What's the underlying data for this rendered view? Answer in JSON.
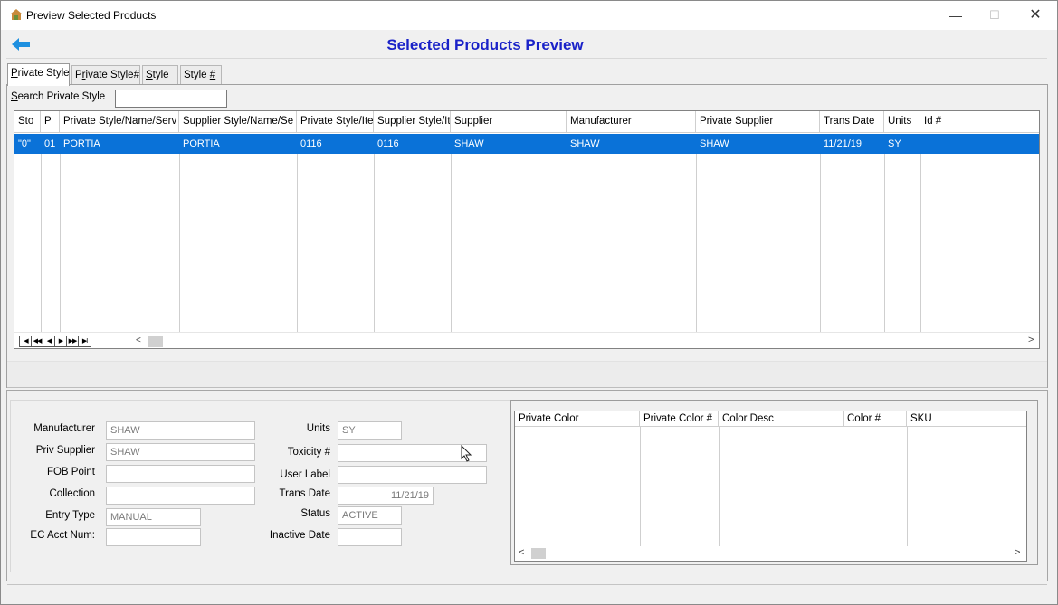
{
  "window": {
    "title": "Preview Selected Products",
    "minimize": "—",
    "maximize": "☐",
    "close": "✕"
  },
  "header": {
    "title": "Selected Products Preview"
  },
  "tabs": [
    {
      "pre": "",
      "key": "P",
      "post": "rivate Style"
    },
    {
      "pre": "P",
      "key": "r",
      "post": "ivate Style#"
    },
    {
      "pre": "",
      "key": "S",
      "post": "tyle"
    },
    {
      "pre": "Style ",
      "key": "#",
      "post": ""
    }
  ],
  "search": {
    "label_key": "S",
    "label_rest": "earch Private Style",
    "value": ""
  },
  "grid": {
    "columns": [
      "Sto",
      "P",
      "Private Style/Name/Serv",
      "Supplier Style/Name/Se",
      "Private Style/Ite",
      "Supplier Style/It",
      "Supplier",
      "Manufacturer",
      "Private Supplier",
      "Trans Date",
      "Units",
      "Id #"
    ],
    "rows": [
      [
        "\"0\"",
        "01",
        "PORTIA",
        "PORTIA",
        "0116",
        "0116",
        "SHAW",
        "SHAW",
        "SHAW",
        "11/21/19",
        "SY",
        ""
      ]
    ],
    "nav_buttons": [
      "I◀",
      "◀◀",
      "◀",
      "▶",
      "▶▶",
      "▶I"
    ],
    "scroll_left": "<",
    "scroll_right": ">"
  },
  "details": {
    "manufacturer": {
      "label": "Manufacturer",
      "value": "SHAW"
    },
    "priv_supplier": {
      "label": "Priv Supplier",
      "value": "SHAW"
    },
    "fob_point": {
      "label": "FOB Point",
      "value": ""
    },
    "collection": {
      "label": "Collection",
      "value": ""
    },
    "entry_type": {
      "label": "Entry Type",
      "value": "MANUAL"
    },
    "ec_acct_num": {
      "label": "EC Acct Num:",
      "value": ""
    },
    "units": {
      "label": "Units",
      "value": "SY"
    },
    "toxicity": {
      "label": "Toxicity #",
      "value": ""
    },
    "user_label": {
      "label": "User Label",
      "value": ""
    },
    "trans_date": {
      "label": "Trans Date",
      "value": "11/21/19"
    },
    "status": {
      "label": "Status",
      "value": "ACTIVE"
    },
    "inactive_date": {
      "label": "Inactive Date",
      "value": ""
    }
  },
  "color_grid": {
    "columns": [
      "Private Color",
      "Private Color #",
      "Color Desc",
      "Color #",
      "SKU"
    ],
    "scroll_left": "<",
    "scroll_right": ">"
  },
  "colors": {
    "accent": "#1a22c8",
    "selection": "#0a72d8",
    "back_arrow": "#1e90e0"
  }
}
